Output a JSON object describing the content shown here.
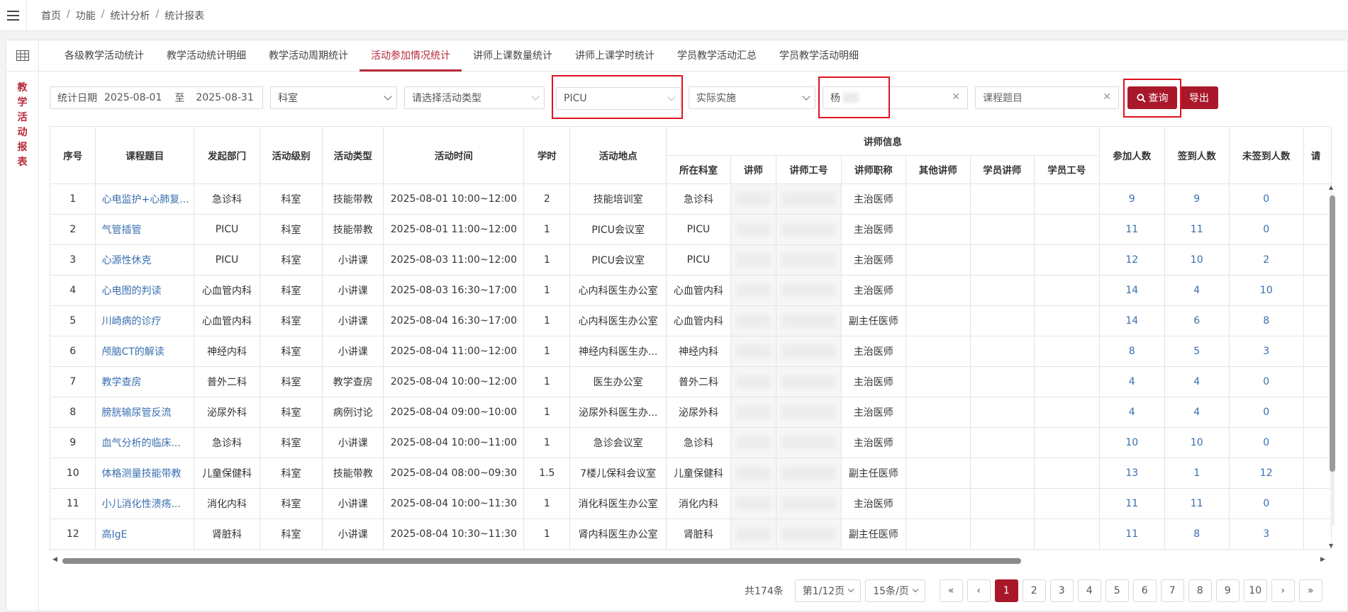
{
  "breadcrumb": [
    "首页",
    "功能",
    "统计分析",
    "统计报表"
  ],
  "sidebar_title": [
    "教",
    "学",
    "活",
    "动",
    "报",
    "表"
  ],
  "tabs": [
    {
      "label": "各级教学活动统计"
    },
    {
      "label": "教学活动统计明细"
    },
    {
      "label": "教学活动周期统计"
    },
    {
      "label": "活动参加情况统计"
    },
    {
      "label": "讲师上课数量统计"
    },
    {
      "label": "讲师上课学时统计"
    },
    {
      "label": "学员教学活动汇总"
    },
    {
      "label": "学员教学活动明细"
    }
  ],
  "active_tab": "活动参加情况统计",
  "filters": {
    "date_label": "统计日期",
    "date_from": "2025-08-01",
    "date_sep": "至",
    "date_to": "2025-08-31",
    "dept_select": "科室",
    "activity_type_placeholder": "请选择活动类型",
    "department_value": "PICU",
    "execution_select": "实际实施",
    "lecturer_value": "杨",
    "course_placeholder": "课程题目",
    "query_label": "查询",
    "export_label": "导出"
  },
  "table": {
    "headers": {
      "seq": "序号",
      "course": "课程题目",
      "origin_dept": "发起部门",
      "level": "活动级别",
      "type": "活动类型",
      "time": "活动时间",
      "hours": "学时",
      "location": "活动地点",
      "lecturer_group": "讲师信息",
      "lecturer_dept": "所在科室",
      "lecturer": "讲师",
      "lecturer_id": "讲师工号",
      "lecturer_title": "讲师职称",
      "other_lecturer": "其他讲师",
      "student_lecturer": "学员讲师",
      "student_id": "学员工号",
      "participants": "参加人数",
      "signed_in": "签到人数",
      "not_signed": "未签到人数",
      "cut_col": "请"
    },
    "rows": [
      {
        "seq": "1",
        "course": "心电监护+心肺复...",
        "origin": "急诊科",
        "level": "科室",
        "type": "技能带教",
        "time": "2025-08-01 10:00~12:00",
        "hours": "2",
        "location": "技能培训室",
        "ldept": "急诊科",
        "title": "主治医师",
        "joined": "9",
        "signed": "9",
        "unsigned": "0"
      },
      {
        "seq": "2",
        "course": "气管插管",
        "origin": "PICU",
        "level": "科室",
        "type": "技能带教",
        "time": "2025-08-01 11:00~12:00",
        "hours": "1",
        "location": "PICU会议室",
        "ldept": "PICU",
        "title": "主治医师",
        "joined": "11",
        "signed": "11",
        "unsigned": "0"
      },
      {
        "seq": "3",
        "course": "心源性休克",
        "origin": "PICU",
        "level": "科室",
        "type": "小讲课",
        "time": "2025-08-03 11:00~12:00",
        "hours": "1",
        "location": "PICU会议室",
        "ldept": "PICU",
        "title": "主治医师",
        "joined": "12",
        "signed": "10",
        "unsigned": "2"
      },
      {
        "seq": "4",
        "course": "心电图的判读",
        "origin": "心血管内科",
        "level": "科室",
        "type": "小讲课",
        "time": "2025-08-03 16:30~17:00",
        "hours": "1",
        "location": "心内科医生办公室",
        "ldept": "心血管内科",
        "title": "主治医师",
        "joined": "14",
        "signed": "4",
        "unsigned": "10"
      },
      {
        "seq": "5",
        "course": "川崎病的诊疗",
        "origin": "心血管内科",
        "level": "科室",
        "type": "小讲课",
        "time": "2025-08-04 16:30~17:00",
        "hours": "1",
        "location": "心内科医生办公室",
        "ldept": "心血管内科",
        "title": "副主任医师",
        "joined": "14",
        "signed": "6",
        "unsigned": "8"
      },
      {
        "seq": "6",
        "course": "颅脑CT的解读",
        "origin": "神经内科",
        "level": "科室",
        "type": "小讲课",
        "time": "2025-08-04 11:00~12:00",
        "hours": "1",
        "location": "神经内科医生办...",
        "ldept": "神经内科",
        "title": "主治医师",
        "joined": "8",
        "signed": "5",
        "unsigned": "3"
      },
      {
        "seq": "7",
        "course": "教学查房",
        "origin": "普外二科",
        "level": "科室",
        "type": "教学查房",
        "time": "2025-08-04 10:00~12:00",
        "hours": "1",
        "location": "医生办公室",
        "ldept": "普外二科",
        "title": "主治医师",
        "joined": "4",
        "signed": "4",
        "unsigned": "0"
      },
      {
        "seq": "8",
        "course": "膀胱输尿管反流",
        "origin": "泌尿外科",
        "level": "科室",
        "type": "病例讨论",
        "time": "2025-08-04 09:00~10:00",
        "hours": "1",
        "location": "泌尿外科医生办...",
        "ldept": "泌尿外科",
        "title": "主治医师",
        "joined": "4",
        "signed": "4",
        "unsigned": "0"
      },
      {
        "seq": "9",
        "course": "血气分析的临床...",
        "origin": "急诊科",
        "level": "科室",
        "type": "小讲课",
        "time": "2025-08-04 10:00~11:00",
        "hours": "1",
        "location": "急诊会议室",
        "ldept": "急诊科",
        "title": "主治医师",
        "joined": "10",
        "signed": "10",
        "unsigned": "0"
      },
      {
        "seq": "10",
        "course": "体格测量技能带教",
        "origin": "儿童保健科",
        "level": "科室",
        "type": "技能带教",
        "time": "2025-08-04 08:00~09:30",
        "hours": "1.5",
        "location": "7楼儿保科会议室",
        "ldept": "儿童保健科",
        "title": "副主任医师",
        "joined": "13",
        "signed": "1",
        "unsigned": "12"
      },
      {
        "seq": "11",
        "course": "小儿消化性溃疡...",
        "origin": "消化内科",
        "level": "科室",
        "type": "小讲课",
        "time": "2025-08-04 10:00~11:30",
        "hours": "1",
        "location": "消化科医生办公室",
        "ldept": "消化内科",
        "title": "主治医师",
        "joined": "11",
        "signed": "11",
        "unsigned": "0"
      },
      {
        "seq": "12",
        "course": "高IgE",
        "origin": "肾脏科",
        "level": "科室",
        "type": "小讲课",
        "time": "2025-08-04 10:30~11:30",
        "hours": "1",
        "location": "肾内科医生办公室",
        "ldept": "肾脏科",
        "title": "副主任医师",
        "joined": "11",
        "signed": "8",
        "unsigned": "3"
      }
    ]
  },
  "pagination": {
    "total": "共174条",
    "page_select": "第1/12页",
    "size_select": "15条/页",
    "first": "«",
    "prev": "‹",
    "pages": [
      "1",
      "2",
      "3",
      "4",
      "5",
      "6",
      "7",
      "8",
      "9",
      "10"
    ],
    "current": "1",
    "next": "›",
    "last": "»"
  },
  "colors": {
    "accent": "#a8182a",
    "link": "#3a6fb0",
    "highlight_box": "#e0121f"
  }
}
